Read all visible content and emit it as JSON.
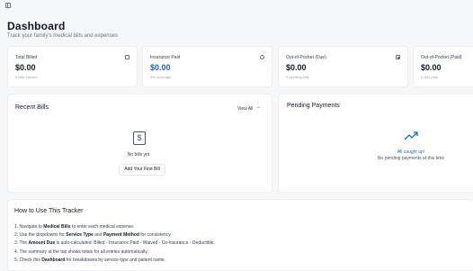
{
  "header": {
    "title": "Dashboard",
    "subtitle": "Track your family's medical bills and expenses"
  },
  "stats": [
    {
      "label": "Total Billed",
      "value": "$0.00",
      "sub": "0 bills tracked",
      "icon": "receipt-icon"
    },
    {
      "label": "Insurance Paid",
      "value": "$0.00",
      "sub": "0% coverage",
      "icon": "circle-icon"
    },
    {
      "label": "Out-of-Pocket (Due)",
      "value": "$0.00",
      "sub": "0 pending bills",
      "icon": "wallet-icon"
    },
    {
      "label": "Out-of-Pocket (Paid)",
      "value": "$0.00",
      "sub": "0 bills paid",
      "icon": "wallet-icon"
    }
  ],
  "recent_bills": {
    "title": "Recent Bills",
    "view_all": "View All",
    "empty_text": "No bills yet",
    "add_button": "Add Your First Bill"
  },
  "pending_payments": {
    "title": "Pending Payments",
    "status": "All caught up!",
    "message": "No pending payments at this time"
  },
  "how_to": {
    "title": "How to Use This Tracker",
    "steps": [
      {
        "prefix": "1. Navigate to ",
        "bold": "Medical Bills",
        "suffix": " to enter each medical expense."
      },
      {
        "prefix": "2. Use the dropdowns for ",
        "bold": "Service Type",
        "middle": " and ",
        "bold2": "Payment Method",
        "suffix": " for consistency."
      },
      {
        "prefix": "3. The ",
        "bold": "Amount Due",
        "suffix": " is auto-calculated: Billed - Insurance Paid - Waived - Co-insurance - Deductible."
      },
      {
        "prefix": "4. The summary at the top shows totals for all entries automatically.",
        "bold": "",
        "suffix": ""
      },
      {
        "prefix": "5. Check this ",
        "bold": "Dashboard",
        "suffix": " for breakdowns by service type and patient name."
      }
    ]
  },
  "colors": {
    "accent": "#1d64c8",
    "background": "#f6f7f8",
    "card": "#ffffff"
  }
}
